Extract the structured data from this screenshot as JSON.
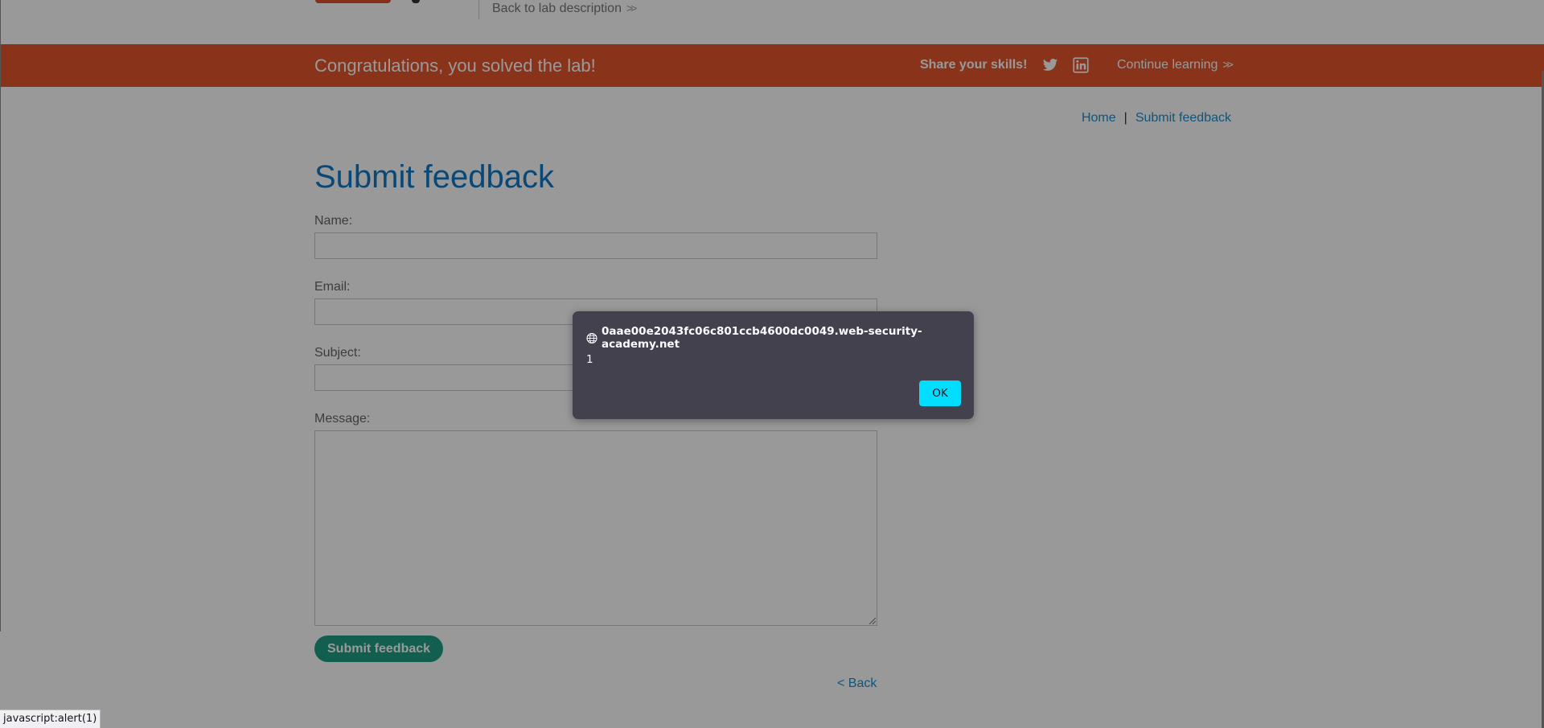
{
  "header": {
    "back_to_lab": "Back to lab description"
  },
  "banner": {
    "title": "Congratulations, you solved the lab!",
    "share_label": "Share your skills!",
    "continue_learning": "Continue learning",
    "color": "#e5562e"
  },
  "nav": {
    "home": "Home",
    "separator": "|",
    "submit_feedback": "Submit feedback"
  },
  "page": {
    "title": "Submit feedback"
  },
  "form": {
    "name_label": "Name:",
    "name_value": "",
    "email_label": "Email:",
    "email_value": "",
    "subject_label": "Subject:",
    "subject_value": "",
    "message_label": "Message:",
    "message_value": "",
    "submit_label": "Submit feedback",
    "back_label": "< Back"
  },
  "dialog": {
    "origin": "0aae00e2043fc06c801ccb4600dc0049.web-security-academy.net",
    "message": "1",
    "ok_label": "OK",
    "ok_color": "#00ddff"
  },
  "status_bar": {
    "text": "javascript:alert(1)"
  }
}
